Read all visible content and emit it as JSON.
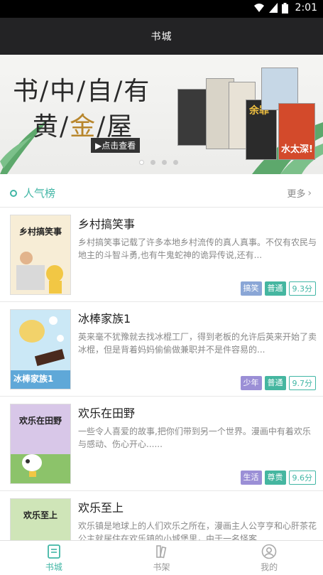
{
  "status_bar": {
    "time": "2:01",
    "icons": [
      "wifi-icon",
      "signal-icon",
      "battery-icon"
    ]
  },
  "header": {
    "title": "书城"
  },
  "banner": {
    "line1": "书/中/自/有",
    "line2_a": "黄/",
    "line2_gold": "金",
    "line2_b": "/屋",
    "button_label": "▶点击查看",
    "slide_count": 4,
    "active_slide": 1,
    "book_labels": [
      "余罪",
      "水太深!"
    ]
  },
  "section": {
    "title": "人气榜",
    "more_label": "更多"
  },
  "books": [
    {
      "cover_title": "乡村搞笑事",
      "title": "乡村搞笑事",
      "description": "乡村搞笑事记载了许多本地乡村流传的真人真事。不仅有农民与地主的斗智斗勇,也有牛鬼蛇神的诡异传说,还有...",
      "tags": [
        {
          "label": "搞笑",
          "color": "#8aa6d6"
        },
        {
          "label": "普通",
          "color": "#45b6a0"
        }
      ],
      "score": "9.3分"
    },
    {
      "cover_title": "冰棒家族1",
      "title": "冰棒家族1",
      "description": "英来毫不犹豫就去找冰棍工厂，得到老板的允许后英来开始了卖冰棍，但是背着妈妈偷偷做兼职并不是件容易的...",
      "tags": [
        {
          "label": "少年",
          "color": "#9b8fd6"
        },
        {
          "label": "普通",
          "color": "#45b6a0"
        }
      ],
      "score": "9.7分"
    },
    {
      "cover_title": "欢乐在田野",
      "title": "欢乐在田野",
      "description": "一些令人喜爱的故事,把你们带到另一个世界。漫画中有着欢乐与感动、伤心开心......",
      "tags": [
        {
          "label": "生活",
          "color": "#9b8fd6"
        },
        {
          "label": "尊贵",
          "color": "#45b6a0"
        }
      ],
      "score": "9.6分"
    },
    {
      "cover_title": "欢乐至上",
      "title": "欢乐至上",
      "description": "欢乐镇是地球上的人们欢乐之所在，漫画主人公亨亨和心肝茶花公主就居住在欢乐镇的小城堡里，由于一名怪客...",
      "tags": [],
      "score": ""
    }
  ],
  "tabs": [
    {
      "label": "书城",
      "icon": "book-city-icon",
      "active": true
    },
    {
      "label": "书架",
      "icon": "bookshelf-icon",
      "active": false
    },
    {
      "label": "我的",
      "icon": "profile-icon",
      "active": false
    }
  ],
  "colors": {
    "accent": "#41b6a5",
    "header_bg": "#232325",
    "status_bg": "#000000"
  }
}
